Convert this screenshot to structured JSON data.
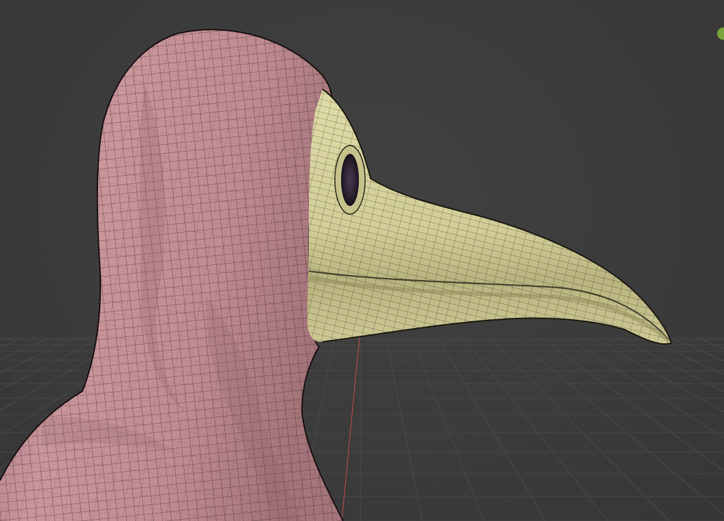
{
  "app": {
    "type": "3d-viewport",
    "mode": "object-wireframe-overlay",
    "background_color": "#3d3d3d",
    "grid_color": "#4a4a4a",
    "axis_x_color": "#b0494e",
    "axis_y_color": "#7aa23d"
  },
  "scene": {
    "objects": [
      {
        "name": "hood-mesh",
        "material_color": "#c28e94",
        "wire_color": "#2b1c1f"
      },
      {
        "name": "beak-mask-mesh",
        "material_color": "#d4d09c",
        "wire_color": "#2a281a"
      }
    ],
    "eye_lens_color": "#2a2030"
  },
  "overlay": {
    "navigation_gizmo_color": "#7aa23d"
  }
}
